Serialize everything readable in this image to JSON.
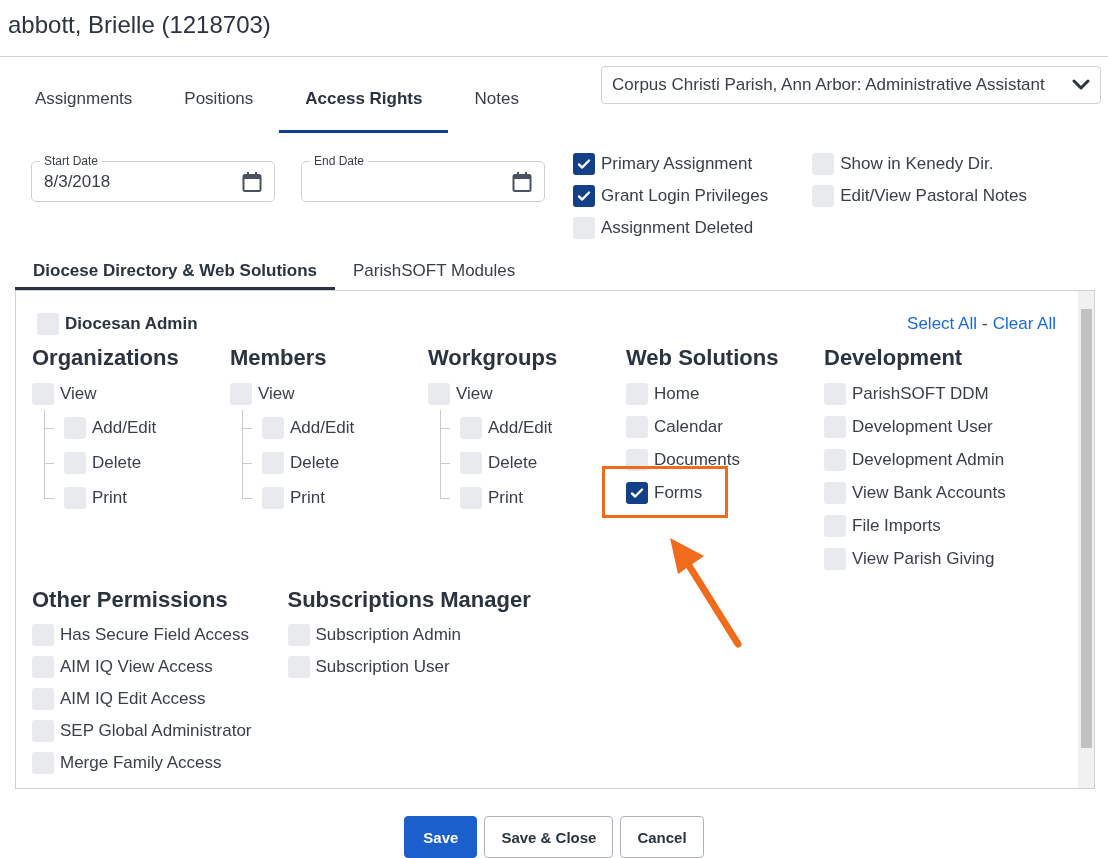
{
  "title": "abbott, Brielle (1218703)",
  "tabs": [
    {
      "label": "Assignments",
      "selected": false
    },
    {
      "label": "Positions",
      "selected": false
    },
    {
      "label": "Access Rights",
      "selected": true
    },
    {
      "label": "Notes",
      "selected": false
    }
  ],
  "assignment_select": {
    "value": "Corpus Christi Parish, Ann Arbor: Administrative Assistant"
  },
  "start_date": {
    "label": "Start Date",
    "value": "8/3/2018"
  },
  "end_date": {
    "label": "End Date"
  },
  "options_columns": [
    [
      {
        "label": "Primary Assignment",
        "checked": true
      },
      {
        "label": "Grant Login Privileges",
        "checked": true
      },
      {
        "label": "Assignment Deleted",
        "checked": false
      }
    ],
    [
      {
        "label": "Show in Kenedy Dir.",
        "checked": false
      },
      {
        "label": "Edit/View Pastoral Notes",
        "checked": false
      }
    ]
  ],
  "sub_tabs": [
    {
      "label": "Diocese Directory & Web Solutions",
      "selected": true
    },
    {
      "label": "ParishSOFT Modules",
      "selected": false
    }
  ],
  "diocesan_admin": {
    "label": "Diocesan Admin",
    "checked": false
  },
  "select_all": "Select All",
  "separator": "-",
  "clear_all": "Clear All",
  "groups": [
    {
      "title": "Organizations",
      "items": [
        {
          "label": "View",
          "checked": false,
          "children": [
            {
              "label": "Add/Edit",
              "checked": false
            },
            {
              "label": "Delete",
              "checked": false
            },
            {
              "label": "Print",
              "checked": false
            }
          ]
        }
      ]
    },
    {
      "title": "Members",
      "items": [
        {
          "label": "View",
          "checked": false,
          "children": [
            {
              "label": "Add/Edit",
              "checked": false
            },
            {
              "label": "Delete",
              "checked": false
            },
            {
              "label": "Print",
              "checked": false
            }
          ]
        }
      ]
    },
    {
      "title": "Workgroups",
      "items": [
        {
          "label": "View",
          "checked": false,
          "children": [
            {
              "label": "Add/Edit",
              "checked": false
            },
            {
              "label": "Delete",
              "checked": false
            },
            {
              "label": "Print",
              "checked": false
            }
          ]
        }
      ]
    },
    {
      "title": "Web Solutions",
      "items": [
        {
          "label": "Home",
          "checked": false
        },
        {
          "label": "Calendar",
          "checked": false
        },
        {
          "label": "Documents",
          "checked": false
        },
        {
          "label": "Forms",
          "checked": true,
          "highlighted": true
        }
      ]
    },
    {
      "title": "Development",
      "items": [
        {
          "label": "ParishSOFT DDM",
          "checked": false
        },
        {
          "label": "Development User",
          "checked": false
        },
        {
          "label": "Development Admin",
          "checked": false
        },
        {
          "label": "View Bank Accounts",
          "checked": false
        },
        {
          "label": "File Imports",
          "checked": false
        },
        {
          "label": "View Parish Giving",
          "checked": false
        }
      ]
    }
  ],
  "lower_groups": [
    {
      "title": "Other Permissions",
      "items": [
        {
          "label": "Has Secure Field Access",
          "checked": false
        },
        {
          "label": "AIM IQ View Access",
          "checked": false
        },
        {
          "label": "AIM IQ Edit Access",
          "checked": false
        },
        {
          "label": "SEP Global Administrator",
          "checked": false
        },
        {
          "label": "Merge Family Access",
          "checked": false
        }
      ]
    },
    {
      "title": "Subscriptions Manager",
      "items": [
        {
          "label": "Subscription Admin",
          "checked": false
        },
        {
          "label": "Subscription User",
          "checked": false
        }
      ]
    }
  ],
  "buttons": [
    {
      "label": "Save",
      "kind": "primary"
    },
    {
      "label": "Save & Close",
      "kind": "secondary"
    },
    {
      "label": "Cancel",
      "kind": "secondary"
    }
  ]
}
